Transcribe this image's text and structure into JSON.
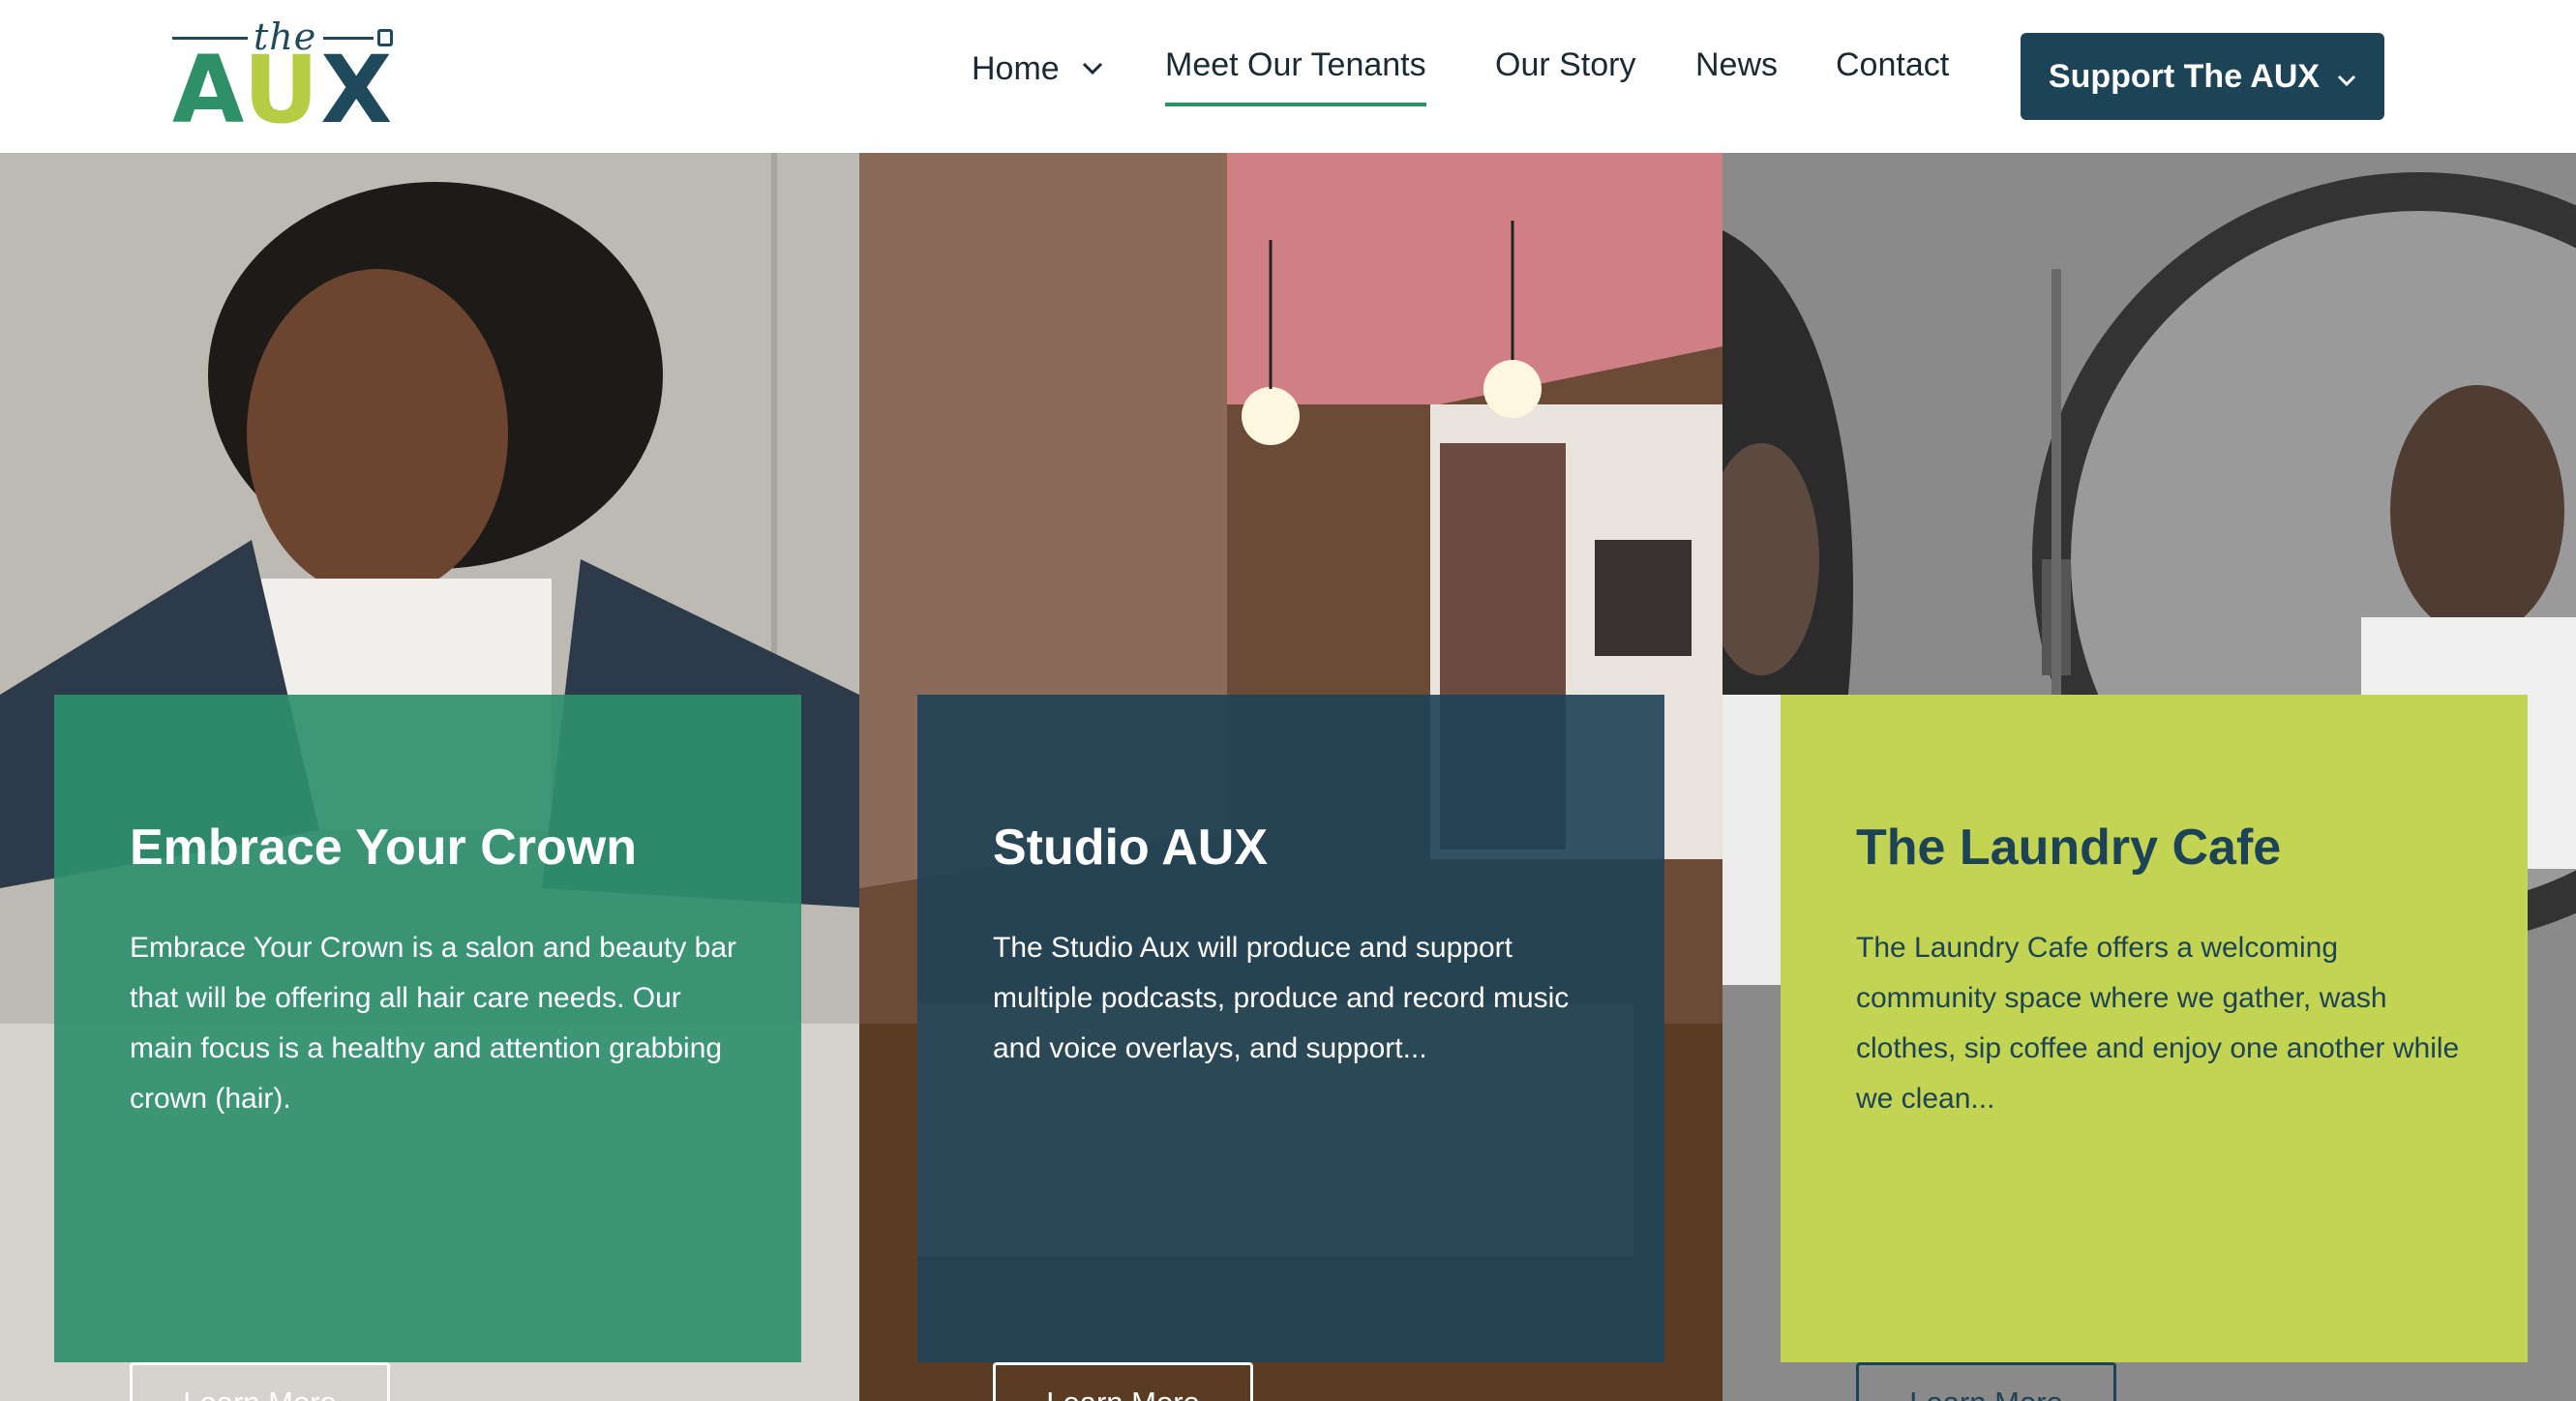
{
  "header": {
    "logo": {
      "the": "the",
      "letters": [
        "A",
        "U",
        "X"
      ]
    },
    "nav": [
      {
        "label": "Home",
        "has_dropdown": true,
        "active": false
      },
      {
        "label": "Meet Our Tenants",
        "has_dropdown": false,
        "active": true
      },
      {
        "label": "Our Story",
        "has_dropdown": false,
        "active": false
      },
      {
        "label": "News",
        "has_dropdown": false,
        "active": false
      },
      {
        "label": "Contact",
        "has_dropdown": false,
        "active": false
      }
    ],
    "cta": {
      "label": "Support The AUX",
      "has_dropdown": true
    }
  },
  "colors": {
    "brand_navy": "#1d4356",
    "brand_green": "#2e9066",
    "brand_lime": "#c3d352",
    "nav_underline": "#2e9066"
  },
  "tenants": [
    {
      "title": "Embrace Your Crown",
      "description": "Embrace Your Crown is a salon and beauty bar that will be offering all hair care needs. Our main focus is a healthy and attention grabbing crown (hair).",
      "button": "Learn More",
      "card_color": "#2f906e"
    },
    {
      "title": "Studio AUX",
      "description": "The Studio Aux will produce and support multiple podcasts, produce and record music and voice overlays, and support...",
      "button": "Learn More",
      "card_color": "#1e4257"
    },
    {
      "title": "The Laundry Cafe",
      "description": "The Laundry Cafe offers a welcoming community space where we gather, wash clothes, sip coffee and enjoy one another while we clean...",
      "button": "Learn More",
      "card_color": "#c3d352"
    }
  ]
}
